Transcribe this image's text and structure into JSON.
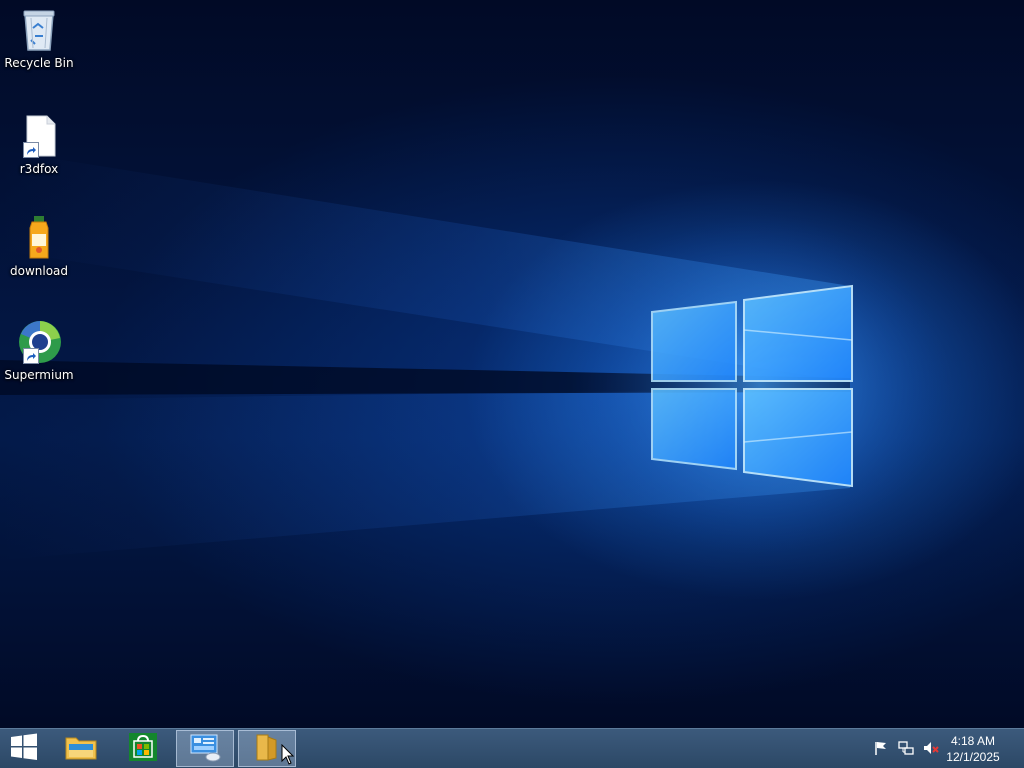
{
  "desktop": {
    "icons": [
      {
        "label": "Recycle Bin",
        "icon": "recycle-bin-icon"
      },
      {
        "label": "r3dfox",
        "icon": "blank-file-shortcut-icon"
      },
      {
        "label": "download",
        "icon": "juice-bottle-icon"
      },
      {
        "label": "Supermium",
        "icon": "supermium-browser-shortcut-icon"
      }
    ],
    "wallpaper": "windows-10-hero-logo"
  },
  "taskbar": {
    "start_icon": "windows-logo-icon",
    "pinned": [
      {
        "icon": "file-explorer-icon",
        "active": false
      },
      {
        "icon": "store-icon",
        "active": false
      },
      {
        "icon": "server-manager-icon",
        "active": true
      },
      {
        "icon": "folder-icon",
        "active": true
      }
    ],
    "tray": [
      "action-center-flag-icon",
      "network-icon",
      "volume-muted-icon"
    ],
    "clock": {
      "time": "4:18 AM",
      "date": "12/1/2025"
    }
  },
  "colors": {
    "taskbar": "#2f4c6c",
    "glow": "#2f8dff",
    "store_green": "#14862d"
  }
}
